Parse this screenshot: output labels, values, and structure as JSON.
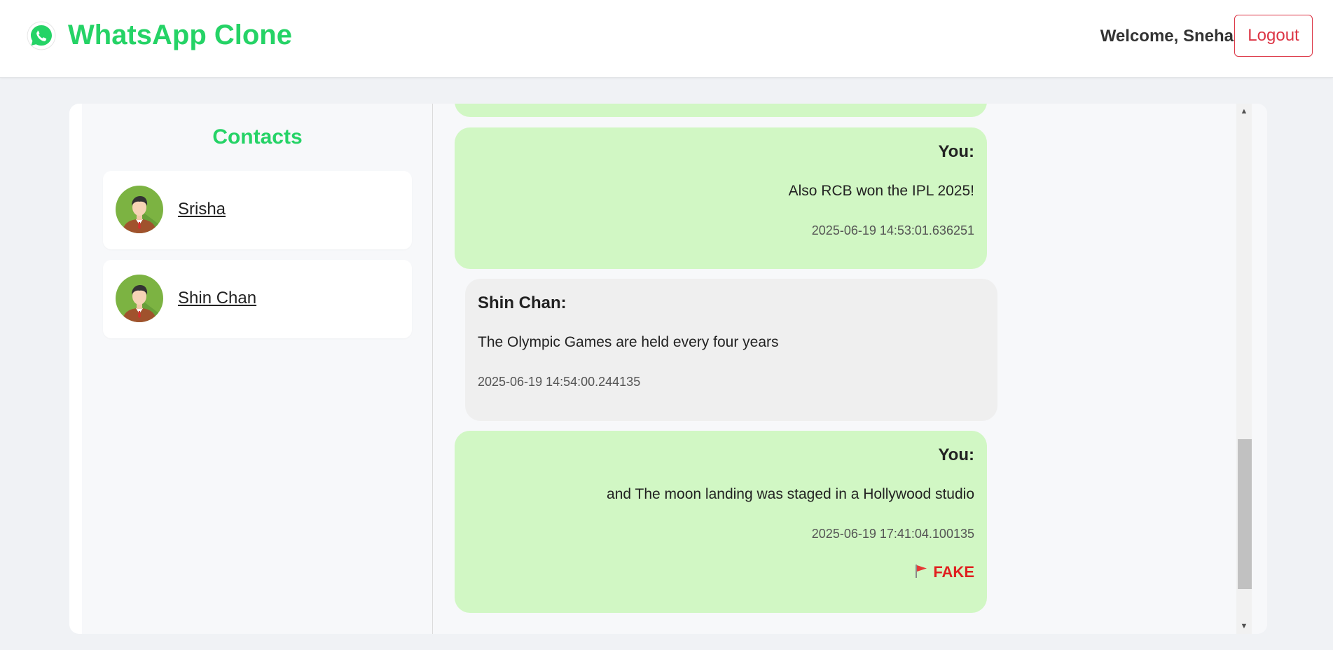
{
  "header": {
    "app_title": "WhatsApp Clone",
    "welcome_text": "Welcome, Sneha",
    "logout_label": "Logout"
  },
  "sidebar": {
    "title": "Contacts",
    "contacts": [
      {
        "name": "Srisha",
        "avatar": "person-avatar-icon"
      },
      {
        "name": "Shin Chan",
        "avatar": "person-avatar-icon"
      }
    ]
  },
  "chat": {
    "messages": [
      {
        "sender": "You:",
        "text": "Also RCB won the IPL 2025!",
        "timestamp": "2025-06-19 14:53:01.636251"
      },
      {
        "sender": "Shin Chan:",
        "text": "The Olympic Games are held every four years",
        "timestamp": "2025-06-19 14:54:00.244135"
      },
      {
        "sender": "You:",
        "text": "and The moon landing was staged in a Hollywood studio",
        "timestamp": "2025-06-19 17:41:04.100135",
        "flag_label": "FAKE"
      }
    ]
  },
  "colors": {
    "brand_green": "#25d366",
    "outgoing_bubble": "#d1f7c4",
    "incoming_bubble": "#efefef",
    "logout_red": "#dc3545",
    "fake_red": "#e02020"
  }
}
